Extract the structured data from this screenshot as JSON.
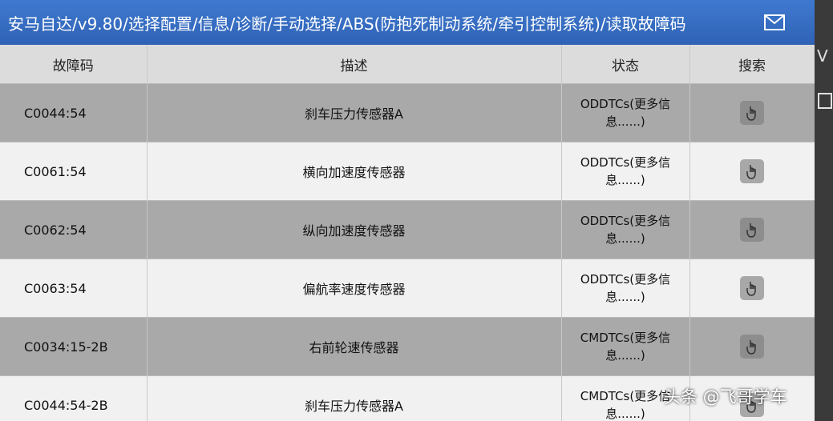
{
  "header": {
    "breadcrumb": "安马自达/v9.80/选择配置/信息/诊断/手动选择/ABS(防抱死制动系统/牵引控制系统)/读取故障码",
    "mail_icon": "mail-icon"
  },
  "right_edge": {
    "char": "V"
  },
  "table": {
    "columns": [
      "故障码",
      "描述",
      "状态",
      "搜索"
    ],
    "rows": [
      {
        "code": "C0044:54",
        "desc": "刹车压力传感器A",
        "status": "ODDTCs(更多信息......)"
      },
      {
        "code": "C0061:54",
        "desc": "横向加速度传感器",
        "status": "ODDTCs(更多信息......)"
      },
      {
        "code": "C0062:54",
        "desc": "纵向加速度传感器",
        "status": "ODDTCs(更多信息......)"
      },
      {
        "code": "C0063:54",
        "desc": "偏航率速度传感器",
        "status": "ODDTCs(更多信息......)"
      },
      {
        "code": "C0034:15-2B",
        "desc": "右前轮速传感器",
        "status": "CMDTCs(更多信息......)"
      },
      {
        "code": "C0044:54-2B",
        "desc": "刹车压力传感器A",
        "status": "CMDTCs(更多信息......)"
      }
    ]
  },
  "watermark": "头条 @飞哥学车",
  "colors": {
    "header": "#2f62b5",
    "row_dark": "#a9a9a9",
    "row_light": "#f1f1f1"
  }
}
